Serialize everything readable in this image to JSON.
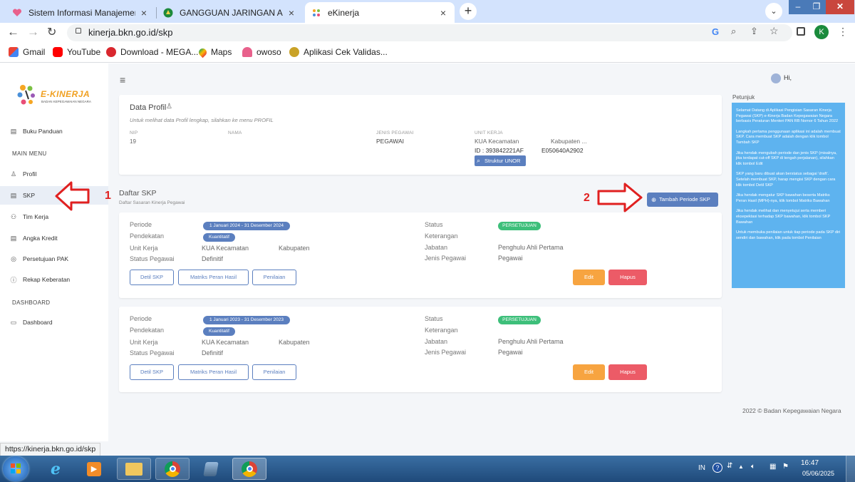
{
  "browser": {
    "tabs": [
      {
        "title": "Sistem Informasi Manajemen Nik"
      },
      {
        "title": "GANGGUAN JARINGAN ABSENSI"
      },
      {
        "title": "eKinerja"
      }
    ],
    "url": "kinerja.bkn.go.id/skp",
    "profile_initial": "K",
    "bookmarks": [
      "Gmail",
      "YouTube",
      "Download - MEGA...",
      "Maps",
      "owoso",
      "Aplikasi Cek Validas..."
    ]
  },
  "app": {
    "logo_text": "E-KINERJA",
    "logo_sub": "BADAN KEPEGAWAIAN NEGARA",
    "greeting": "Hi,",
    "sidebar": {
      "top_item": "Buku Panduan",
      "main_menu_head": "MAIN MENU",
      "items": [
        "Profil",
        "SKP",
        "Tim Kerja",
        "Angka Kredit",
        "Persetujuan PAK",
        "Rekap Keberatan"
      ],
      "dashboard_head": "DASHBOARD",
      "dashboard_item": "Dashboard"
    },
    "profile": {
      "title": "Data Profil",
      "subtitle": "Untuk melihat data Profil lengkap, silahkan ke menu PROFIL",
      "nip_label": "NIP",
      "nip_value": "19",
      "nama_label": "NAMA",
      "jenis_label": "JENIS PEGAWAI",
      "jenis_value": "PEGAWAI",
      "unit_label": "UNIT KERJA",
      "unit_value": "KUA Kecamatan",
      "unit_value2": "Kabupaten ...",
      "id_value": "ID : 393842221AF",
      "code_value": "E050640A2902",
      "struktur_button": "Struktur UNOR"
    },
    "skp": {
      "title": "Daftar SKP",
      "subtitle": "Daftar Sasaran Kinerja Pegawai",
      "add_button": "Tambah Periode SKP",
      "labels": {
        "periode": "Periode",
        "pendekatan": "Pendekatan",
        "unit": "Unit Kerja",
        "status_pegawai": "Status Pegawai",
        "status": "Status",
        "keterangan": "Keterangan",
        "jabatan": "Jabatan",
        "jenis": "Jenis Pegawai"
      },
      "cards": [
        {
          "periode": "1 Januari 2024 - 31 Desember 2024",
          "pendekatan": "Kuantitatif",
          "unit": "KUA Kecamatan",
          "unit2": "Kabupaten",
          "status_pegawai": "Definitif",
          "status": "PERSETUJUAN",
          "jabatan": "Penghulu Ahli Pertama",
          "jenis": "Pegawai",
          "btn_detil": "Detil SKP",
          "btn_matriks": "Matriks Peran Hasil",
          "btn_penilaian": "Penilaian",
          "btn_edit": "Edit",
          "btn_hapus": "Hapus"
        },
        {
          "periode": "1 Januari 2023 - 31 Desember 2023",
          "pendekatan": "Kuantitatif",
          "unit": "KUA Kecamatan",
          "unit2": "Kabupaten",
          "status_pegawai": "Definitif",
          "status": "PERSETUJUAN",
          "jabatan": "Penghulu Ahli Pertama",
          "jenis": "Pegawai",
          "btn_detil": "Detil SKP",
          "btn_matriks": "Matriks Peran Hasil",
          "btn_penilaian": "Penilaian",
          "btn_edit": "Edit",
          "btn_hapus": "Hapus"
        }
      ]
    },
    "petunjuk": {
      "title": "Petunjuk",
      "paragraphs": [
        "Selamat Datang di Aplikasi Pengisian Sasaran Kinerja Pegawai (SKP) e-Kinerja Badan Kepegawaian Negara berbasis Peraturan Menteri PAN RB Nomor 6 Tahun 2022",
        "Langkah pertama penggunaan aplikasi ini adalah membuat SKP. Cara membuat SKP adalah dengan klik tombol Tambah SKP",
        "Jika hendak mengubah periode dan jenis SKP (misalnya, jika terdapat cut-off SKP di tengah perjalanan), silahkan klik tombol Edit",
        "SKP yang baru dibuat akan berstatus sebagai 'draft'. Setelah membuat SKP, harap mengisi SKP dengan cara klik tombol Detil SKP",
        "Jika hendak mengatur SKP bawahan beserta Matriks Peran Hasil (MPH)-nya, klik tombol Matriks Bawahan",
        "Jika hendak melihat dan menyetujui serta memberi eksepektasi terhadap SKP bawahan, klik tombol SKP Bawahan",
        "Untuk membuka penilaian untuk tiap periode pada SKP diri sendiri dan bawahan, klik pada tombol Penilaian"
      ]
    },
    "footer": "2022 © Badan Kepegawaian Negara",
    "annotations": {
      "one": "1",
      "two": "2"
    }
  },
  "status_url": "https://kinerja.bkn.go.id/skp",
  "taskbar": {
    "lang": "IN",
    "time": "16:47",
    "date": "05/06/2025"
  }
}
